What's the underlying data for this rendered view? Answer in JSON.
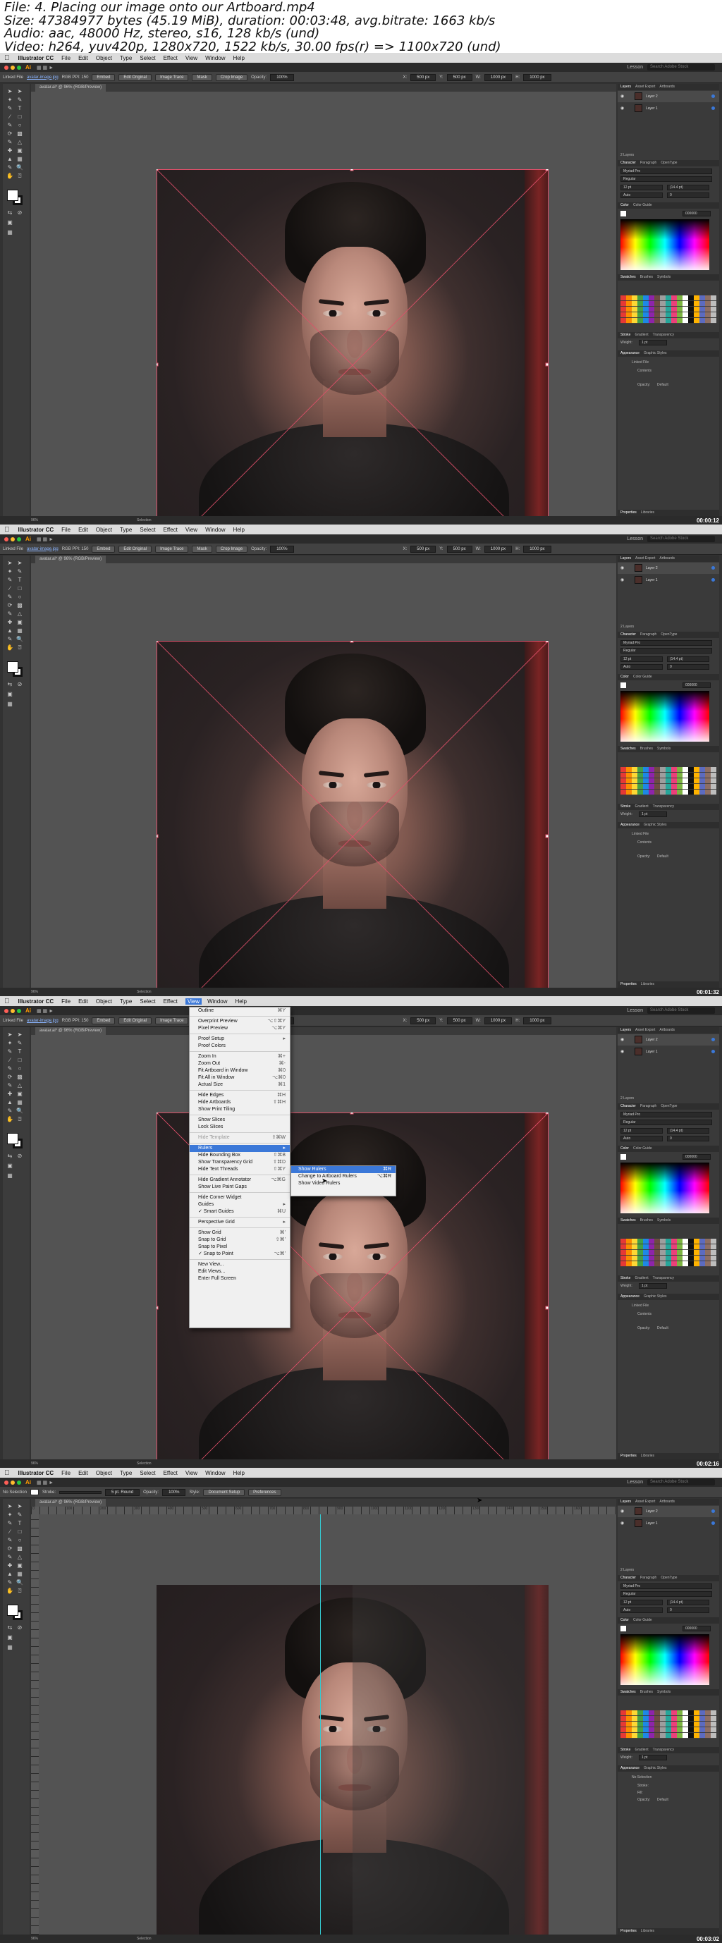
{
  "header": {
    "file": "File: 4. Placing our image onto our Artboard.mp4",
    "size": "Size: 47384977 bytes (45.19 MiB), duration: 00:03:48, avg.bitrate: 1663 kb/s",
    "audio": "Audio: aac, 48000 Hz, stereo, s16, 128 kb/s (und)",
    "video": "Video: h264, yuv420p, 1280x720, 1522 kb/s, 30.00 fps(r) => 1100x720 (und)"
  },
  "menubar": {
    "app": "Illustrator CC",
    "items": [
      "File",
      "Edit",
      "Object",
      "Type",
      "Select",
      "Effect",
      "View",
      "Window",
      "Help"
    ],
    "launch": "Lesson",
    "search_placeholder": "Search Adobe Stock"
  },
  "control_bar": {
    "linked_file": "Linked File",
    "filename": "avatar-image.jpg",
    "color_mode": "RGB  PPI: 150",
    "embed": "Embed",
    "edit_original": "Edit Original",
    "image_trace": "Image Trace",
    "mask": "Mask",
    "crop_image": "Crop Image",
    "opacity_label": "Opacity:",
    "opacity_value": "100%",
    "x_value": "500 px",
    "y_value": "500 px",
    "w_value": "1000 px",
    "h_value": "1000 px"
  },
  "control_bar_alt": {
    "no_selection": "No Selection",
    "stroke_label": "Stroke:",
    "brush": "5 pt. Round",
    "opacity_label": "Opacity:",
    "opacity_value": "100%",
    "style_label": "Style:",
    "doc_setup": "Document Setup",
    "preferences": "Preferences"
  },
  "document_tab": "avatar.ai* @ 96% (RGB/Preview)",
  "ruler_ticks": [
    "0",
    "100",
    "200",
    "300",
    "400",
    "500",
    "600",
    "700",
    "800",
    "900",
    "1000",
    "1100",
    "1200",
    "1300",
    "1400",
    "1500",
    "1600"
  ],
  "panels": {
    "layer_tabs": [
      "Layers",
      "Asset Export",
      "Artboards"
    ],
    "layers": [
      "Layer 2",
      "Layer 1"
    ],
    "layers_count": "2 Layers",
    "char_tabs": [
      "Character",
      "Paragraph",
      "OpenType"
    ],
    "font": "Myriad Pro",
    "font_style": "Regular",
    "font_size": "12 pt",
    "leading": "(14.4 pt)",
    "tracking": "Auto",
    "kerning": "0",
    "color_tabs": [
      "Color",
      "Color Guide"
    ],
    "hex": "000000",
    "swatch_tabs": [
      "Swatches",
      "Brushes",
      "Symbols"
    ],
    "stroke_tabs": [
      "Stroke",
      "Gradient",
      "Transparency"
    ],
    "weight_label": "Weight:",
    "weight": "1 pt",
    "appearance_tabs": [
      "Appearance",
      "Graphic Styles"
    ],
    "linked_file": "Linked File",
    "contents": "Contents",
    "opacity": "Opacity:",
    "opacity_value": "Default",
    "library": "Libraries",
    "properties_tabs": [
      "Properties",
      "Libraries"
    ],
    "no_selection": "No Selection",
    "stroke_row": "Stroke:",
    "fill_row": "Fill:"
  },
  "statusbar": {
    "zoom": "96%",
    "tool": "Selection"
  },
  "timestamps": [
    "00:00:12",
    "00:01:32",
    "00:02:16",
    "00:03:02"
  ],
  "view_menu": {
    "items": [
      {
        "label": "Outline",
        "shortcut": "⌘Y"
      },
      {
        "sep": true
      },
      {
        "label": "Overprint Preview",
        "shortcut": "⌥⇧⌘Y"
      },
      {
        "label": "Pixel Preview",
        "shortcut": "⌥⌘Y"
      },
      {
        "sep": true
      },
      {
        "label": "Proof Setup",
        "shortcut": "▸"
      },
      {
        "label": "Proof Colors",
        "shortcut": ""
      },
      {
        "sep": true
      },
      {
        "label": "Zoom In",
        "shortcut": "⌘+"
      },
      {
        "label": "Zoom Out",
        "shortcut": "⌘-"
      },
      {
        "label": "Fit Artboard in Window",
        "shortcut": "⌘0"
      },
      {
        "label": "Fit All in Window",
        "shortcut": "⌥⌘0"
      },
      {
        "label": "Actual Size",
        "shortcut": "⌘1"
      },
      {
        "sep": true
      },
      {
        "label": "Hide Edges",
        "shortcut": "⌘H"
      },
      {
        "label": "Hide Artboards",
        "shortcut": "⇧⌘H"
      },
      {
        "label": "Show Print Tiling",
        "shortcut": ""
      },
      {
        "sep": true
      },
      {
        "label": "Show Slices",
        "shortcut": ""
      },
      {
        "label": "Lock Slices",
        "shortcut": ""
      },
      {
        "sep": true
      },
      {
        "label": "Hide Template",
        "shortcut": "⇧⌘W",
        "disabled": true
      },
      {
        "sep": true
      },
      {
        "label": "Rulers",
        "shortcut": "▸",
        "highlighted": true
      },
      {
        "label": "Hide Bounding Box",
        "shortcut": "⇧⌘B"
      },
      {
        "label": "Show Transparency Grid",
        "shortcut": "⇧⌘D"
      },
      {
        "label": "Hide Text Threads",
        "shortcut": "⇧⌘Y"
      },
      {
        "sep": true
      },
      {
        "label": "Hide Gradient Annotator",
        "shortcut": "⌥⌘G"
      },
      {
        "label": "Show Live Paint Gaps",
        "shortcut": ""
      },
      {
        "sep": true
      },
      {
        "label": "Hide Corner Widget",
        "shortcut": ""
      },
      {
        "label": "Guides",
        "shortcut": "▸"
      },
      {
        "label": "✓ Smart Guides",
        "shortcut": "⌘U"
      },
      {
        "sep": true
      },
      {
        "label": "Perspective Grid",
        "shortcut": "▸"
      },
      {
        "sep": true
      },
      {
        "label": "Show Grid",
        "shortcut": "⌘'"
      },
      {
        "label": "Snap to Grid",
        "shortcut": "⇧⌘'"
      },
      {
        "label": "Snap to Pixel",
        "shortcut": ""
      },
      {
        "label": "✓ Snap to Point",
        "shortcut": "⌥⌘'"
      },
      {
        "sep": true
      },
      {
        "label": "New View...",
        "shortcut": ""
      },
      {
        "label": "Edit Views...",
        "shortcut": ""
      },
      {
        "label": "Enter Full Screen",
        "shortcut": ""
      }
    ]
  },
  "rulers_submenu": {
    "items": [
      {
        "label": "Show Rulers",
        "shortcut": "⌘R",
        "highlighted": true
      },
      {
        "label": "Change to Artboard Rulers",
        "shortcut": "⌥⌘R"
      },
      {
        "label": "Show Video Rulers",
        "shortcut": ""
      }
    ]
  },
  "colors": {
    "ui_dark": "#323232",
    "panel": "#3a3a3a",
    "canvas": "#535353",
    "accent": "#3b78d8",
    "guide": "#35c9d0",
    "artboard_edge": "#e0506a"
  }
}
